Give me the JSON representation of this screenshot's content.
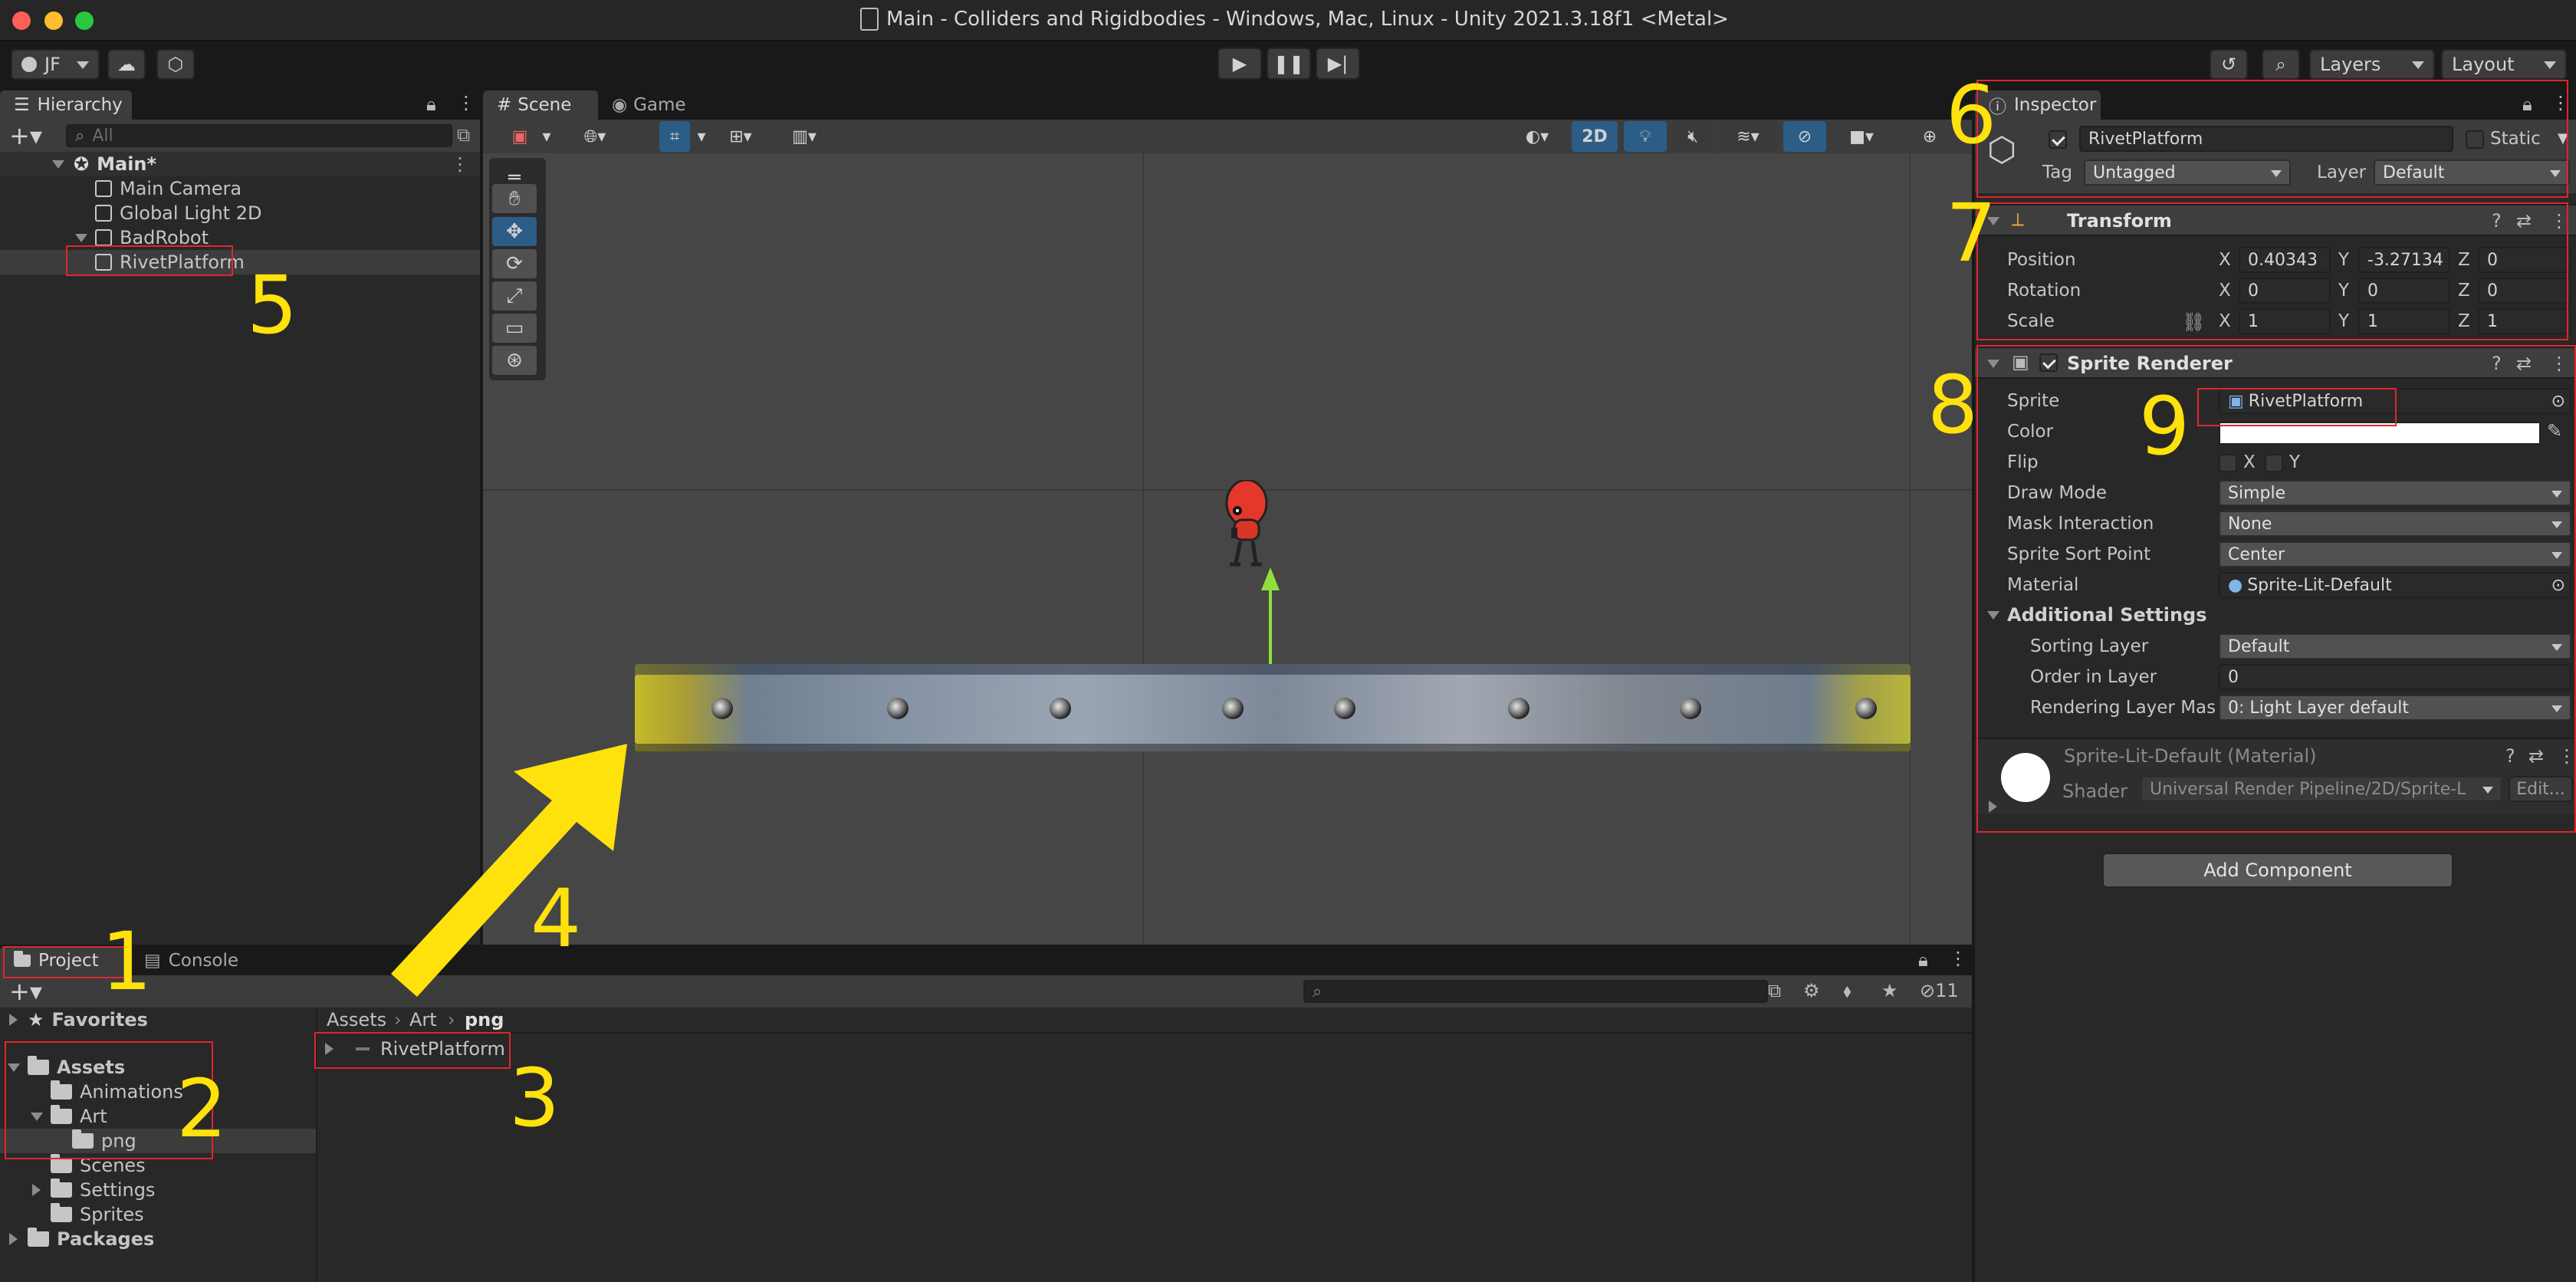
{
  "window": {
    "title": "Main - Colliders and Rigidbodies - Windows, Mac, Linux - Unity 2021.3.18f1 <Metal>"
  },
  "toolbar": {
    "account": "JF",
    "layers": "Layers",
    "layout": "Layout"
  },
  "hierarchy": {
    "tab": "Hierarchy",
    "search_placeholder": "All",
    "scene": "Main*",
    "items": [
      "Main Camera",
      "Global Light 2D",
      "BadRobot",
      "RivetPlatform"
    ]
  },
  "scene_view": {
    "tabs": [
      "Scene",
      "Game"
    ],
    "mode_2d": "2D"
  },
  "project": {
    "tabs": [
      "Project",
      "Console"
    ],
    "hidden_count": "11",
    "tree": {
      "favorites": "Favorites",
      "assets": "Assets",
      "animations": "Animations",
      "art": "Art",
      "png": "png",
      "scenes": "Scenes",
      "settings": "Settings",
      "sprites": "Sprites",
      "packages": "Packages"
    },
    "breadcrumb": [
      "Assets",
      "Art",
      "png"
    ],
    "asset": "RivetPlatform"
  },
  "inspector": {
    "tab": "Inspector",
    "object_name": "RivetPlatform",
    "static_label": "Static",
    "tag_label": "Tag",
    "tag_value": "Untagged",
    "layer_label": "Layer",
    "layer_value": "Default",
    "transform": {
      "title": "Transform",
      "position_label": "Position",
      "rotation_label": "Rotation",
      "scale_label": "Scale",
      "position": {
        "x": "0.40343",
        "y": "-3.27134",
        "z": "0"
      },
      "rotation": {
        "x": "0",
        "y": "0",
        "z": "0"
      },
      "scale": {
        "x": "1",
        "y": "1",
        "z": "1"
      }
    },
    "sprite_renderer": {
      "title": "Sprite Renderer",
      "sprite_label": "Sprite",
      "sprite_value": "RivetPlatform",
      "color_label": "Color",
      "flip_label": "Flip",
      "flip_x": "X",
      "flip_y": "Y",
      "draw_mode_label": "Draw Mode",
      "draw_mode_value": "Simple",
      "mask_label": "Mask Interaction",
      "mask_value": "None",
      "sort_point_label": "Sprite Sort Point",
      "sort_point_value": "Center",
      "material_label": "Material",
      "material_value": "Sprite-Lit-Default",
      "additional_settings": "Additional Settings",
      "sorting_layer_label": "Sorting Layer",
      "sorting_layer_value": "Default",
      "order_label": "Order in Layer",
      "order_value": "0",
      "rendering_mask_label": "Rendering Layer Mas",
      "rendering_mask_value": "0: Light Layer default"
    },
    "material": {
      "title": "Sprite-Lit-Default (Material)",
      "shader_label": "Shader",
      "shader_value": "Universal Render Pipeline/2D/Sprite-L",
      "edit_label": "Edit..."
    },
    "add_component": "Add Component"
  },
  "annotations": [
    "1",
    "2",
    "3",
    "4",
    "5",
    "6",
    "7",
    "8",
    "9"
  ],
  "colors": {
    "annotation_yellow": "#ffe20c",
    "highlight_red": "#e0262b",
    "selection": "#2c5d87"
  }
}
